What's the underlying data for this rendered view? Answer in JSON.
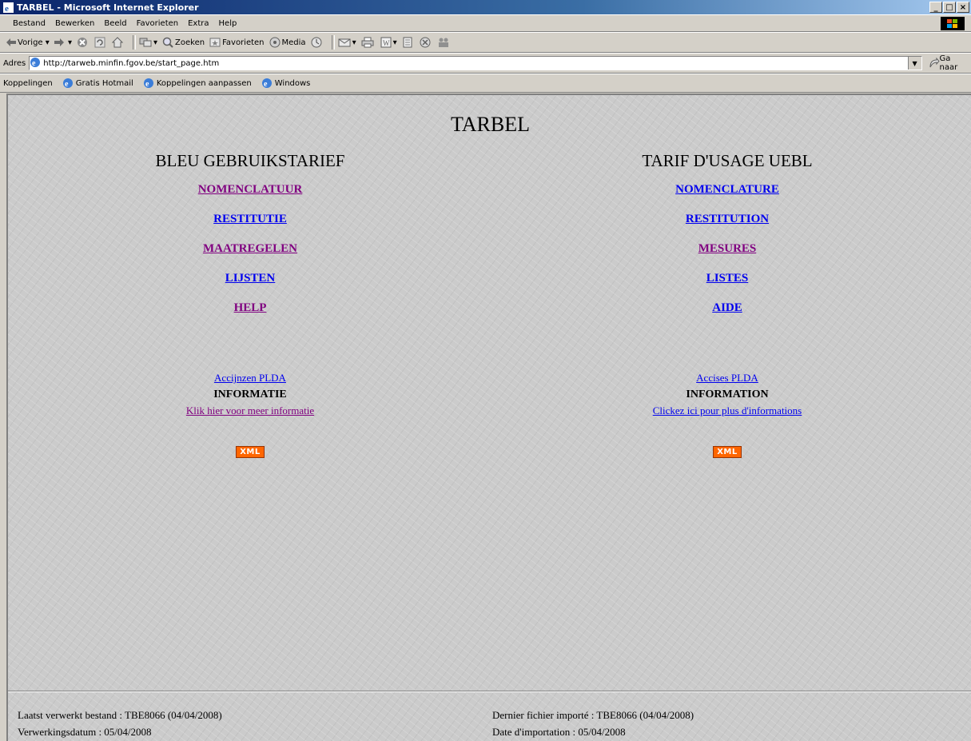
{
  "window": {
    "title": "TARBEL - Microsoft Internet Explorer"
  },
  "menu": {
    "items": [
      "Bestand",
      "Bewerken",
      "Beeld",
      "Favorieten",
      "Extra",
      "Help"
    ]
  },
  "toolbar": {
    "back_label": "Vorige",
    "search_label": "Zoeken",
    "favorites_label": "Favorieten",
    "media_label": "Media"
  },
  "address": {
    "label": "Adres",
    "url": "http://tarweb.minfin.fgov.be/start_page.htm",
    "go_label": "Ga naar"
  },
  "links": {
    "label": "Koppelingen",
    "items": [
      "Gratis Hotmail",
      "Koppelingen aanpassen",
      "Windows"
    ]
  },
  "page": {
    "title": "TARBEL",
    "left": {
      "heading": "BLEU GEBRUIKSTARIEF",
      "links": [
        "NOMENCLATUUR",
        "RESTITUTIE",
        "MAATREGELEN",
        "LIJSTEN",
        "HELP"
      ],
      "excise": "Accijnzen PLDA",
      "info_heading": "INFORMATIE",
      "info_link": "Klik hier voor meer informatie",
      "xml": "XML"
    },
    "right": {
      "heading": "TARIF D'USAGE UEBL",
      "links": [
        "NOMENCLATURE",
        "RESTITUTION",
        "MESURES",
        "LISTES",
        "AIDE"
      ],
      "excise": "Accises PLDA",
      "info_heading": "INFORMATION",
      "info_link": "Clickez ici pour plus d'informations",
      "xml": "XML"
    },
    "footer": {
      "left_line1": "Laatst verwerkt bestand : TBE8066 (04/04/2008)",
      "left_line2": "Verwerkingsdatum : 05/04/2008",
      "right_line1": "Dernier fichier importé : TBE8066 (04/04/2008)",
      "right_line2": "Date d'importation : 05/04/2008"
    }
  }
}
